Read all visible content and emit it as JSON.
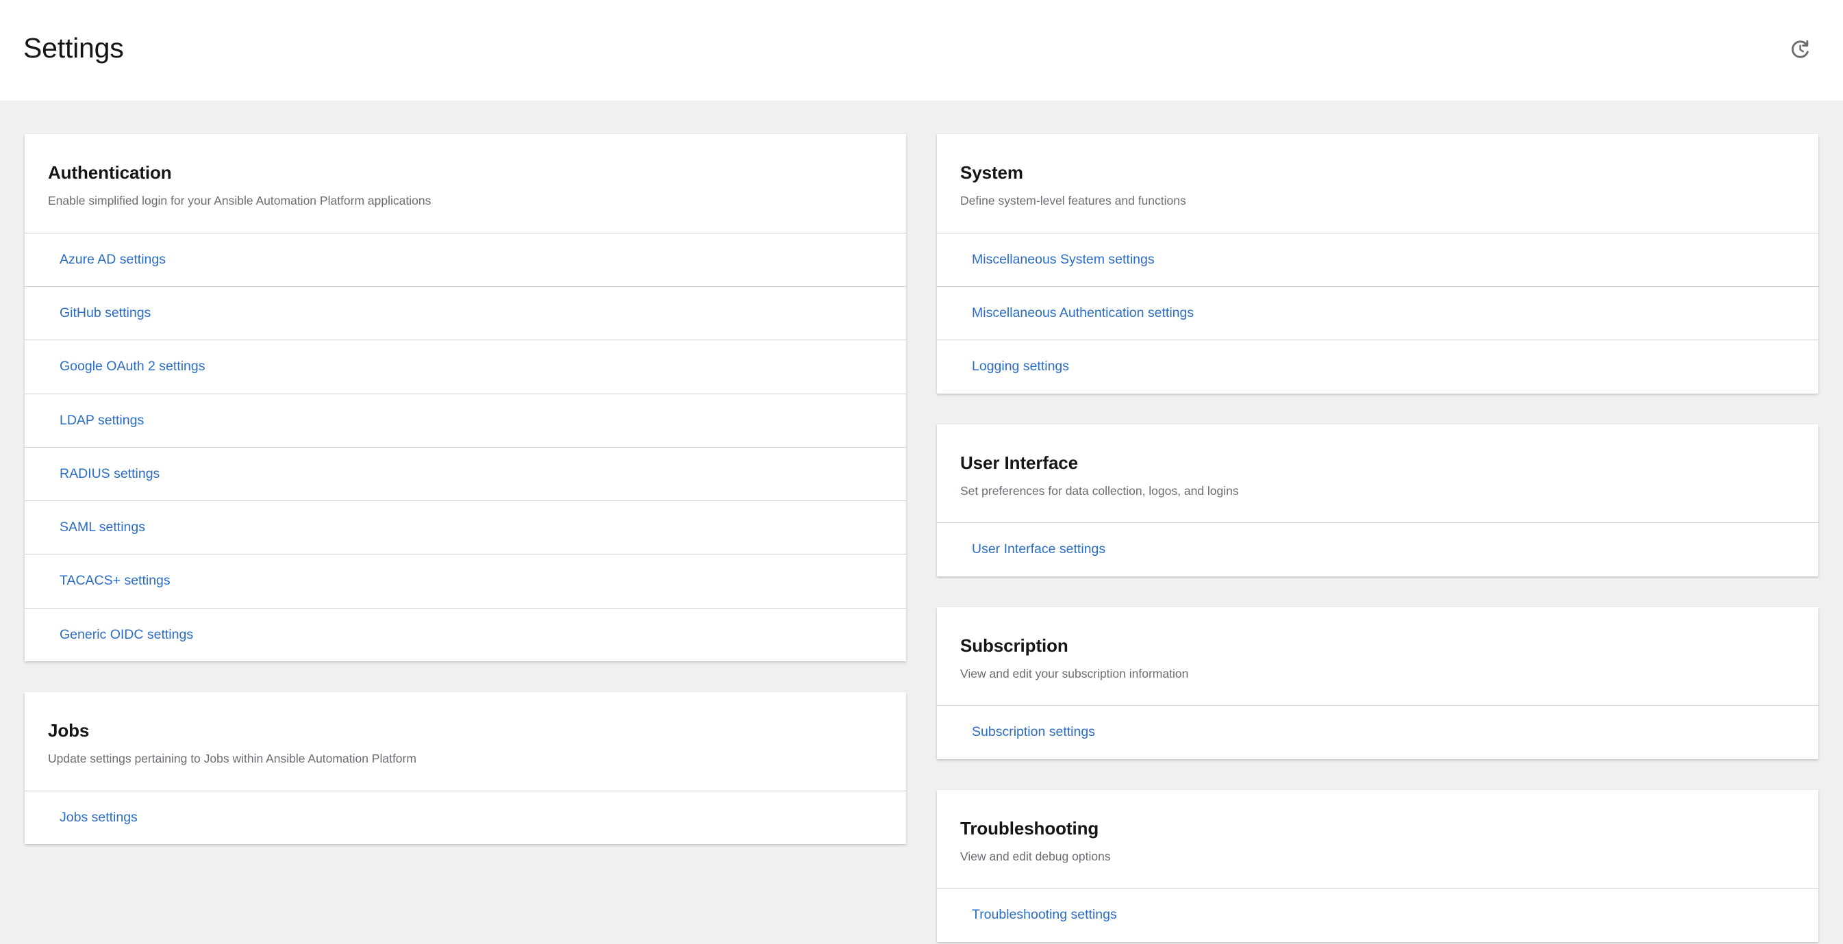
{
  "header": {
    "title": "Settings",
    "actions": [
      {
        "icon": "history-icon",
        "label": "History"
      }
    ]
  },
  "colors": {
    "link": "#2b6cc4",
    "page_background": "#f0f0f0",
    "card_background": "#ffffff",
    "divider": "#d2d2d2",
    "title_text": "#151515",
    "description_text": "#6a6e73",
    "icon": "#6a6e73"
  },
  "columns": [
    {
      "cards": [
        {
          "title": "Authentication",
          "description": "Enable simplified login for your Ansible Automation Platform applications",
          "links": [
            "Azure AD settings",
            "GitHub settings",
            "Google OAuth 2 settings",
            "LDAP settings",
            "RADIUS settings",
            "SAML settings",
            "TACACS+ settings",
            "Generic OIDC settings"
          ]
        },
        {
          "title": "Jobs",
          "description": "Update settings pertaining to Jobs within Ansible Automation Platform",
          "links": [
            "Jobs settings"
          ]
        }
      ]
    },
    {
      "cards": [
        {
          "title": "System",
          "description": "Define system-level features and functions",
          "links": [
            "Miscellaneous System settings",
            "Miscellaneous Authentication settings",
            "Logging settings"
          ]
        },
        {
          "title": "User Interface",
          "description": "Set preferences for data collection, logos, and logins",
          "links": [
            "User Interface settings"
          ]
        },
        {
          "title": "Subscription",
          "description": "View and edit your subscription information",
          "links": [
            "Subscription settings"
          ]
        },
        {
          "title": "Troubleshooting",
          "description": "View and edit debug options",
          "links": [
            "Troubleshooting settings"
          ]
        }
      ]
    }
  ]
}
